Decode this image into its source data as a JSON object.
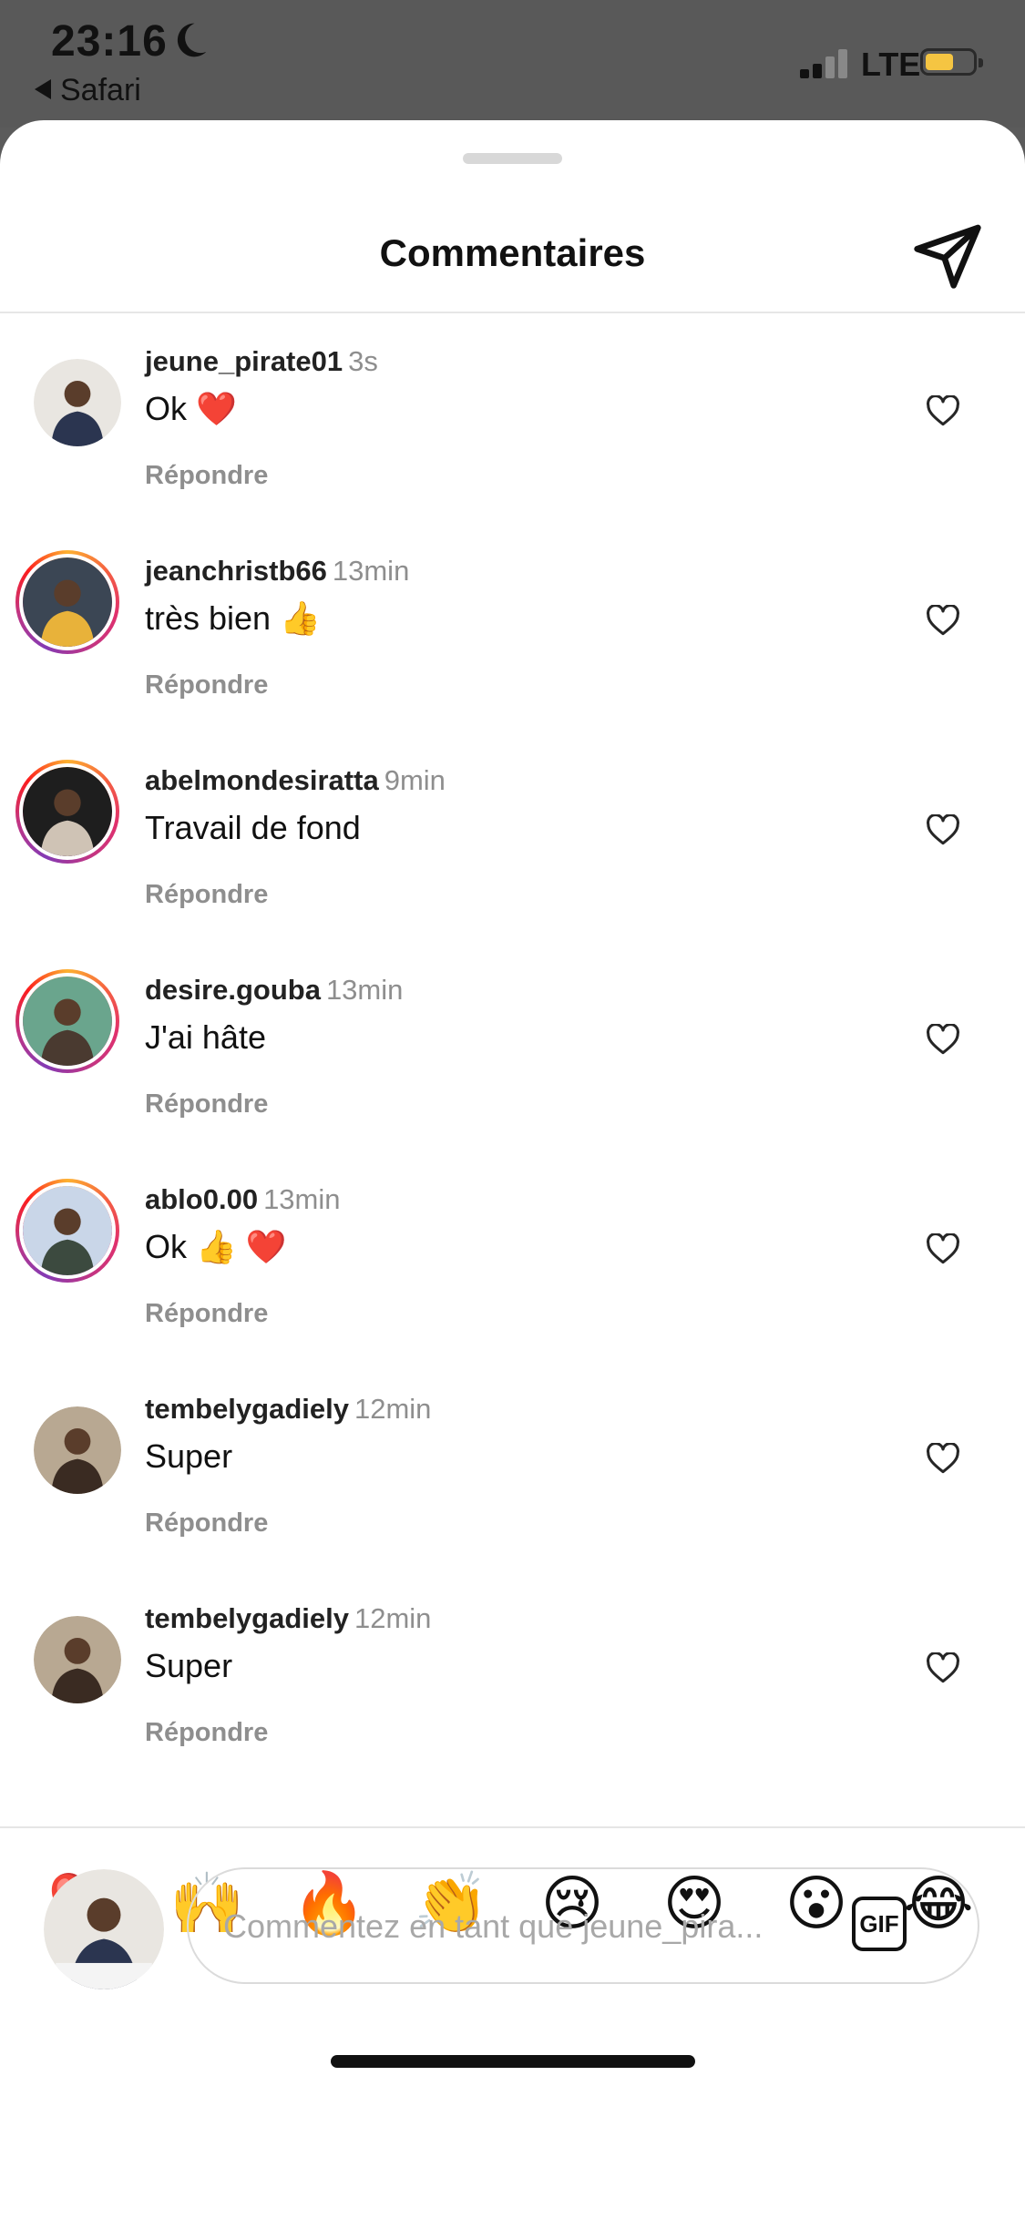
{
  "status_bar": {
    "time": "23:16",
    "back_app": "Safari",
    "network": "LTE",
    "battery_level": 0.6,
    "battery_color": "#f5c542"
  },
  "sheet": {
    "title": "Commentaires",
    "send_icon": "paper-plane-icon"
  },
  "comments": [
    {
      "username": "jeune_pirate01",
      "time": "3s",
      "text": "Ok ❤️",
      "reply": "Répondre",
      "story_ring": false,
      "avatar_colors": [
        "#e9e6e1",
        "#2b3550"
      ]
    },
    {
      "username": "jeanchristb66",
      "time": "13min",
      "text": "très bien 👍",
      "reply": "Répondre",
      "story_ring": true,
      "avatar_colors": [
        "#3b4654",
        "#e8b23a"
      ]
    },
    {
      "username": "abelmondesiratta",
      "time": "9min",
      "text": "Travail de fond",
      "reply": "Répondre",
      "story_ring": true,
      "avatar_colors": [
        "#1e1e1e",
        "#cfc3b5"
      ]
    },
    {
      "username": "desire.gouba",
      "time": "13min",
      "text": "J'ai hâte",
      "reply": "Répondre",
      "story_ring": true,
      "avatar_colors": [
        "#6aa58d",
        "#4a3a30"
      ]
    },
    {
      "username": "ablo0.00",
      "time": "13min",
      "text": "Ok 👍 ❤️",
      "reply": "Répondre",
      "story_ring": true,
      "avatar_colors": [
        "#c9d6e8",
        "#3c4a3f"
      ]
    },
    {
      "username": "tembelygadiely",
      "time": "12min",
      "text": "Super",
      "reply": "Répondre",
      "story_ring": false,
      "avatar_colors": [
        "#b8a892",
        "#3a2b22"
      ]
    },
    {
      "username": "tembelygadiely",
      "time": "12min",
      "text": "Super",
      "reply": "Répondre",
      "story_ring": false,
      "avatar_colors": [
        "#b8a892",
        "#3a2b22"
      ]
    }
  ],
  "quick_reactions": [
    "❤️",
    "🙌",
    "🔥",
    "👏",
    "😢",
    "😍",
    "😮",
    "😂"
  ],
  "composer": {
    "placeholder": "Commentez en tant que jeune_pira...",
    "gif_label": "GIF"
  }
}
